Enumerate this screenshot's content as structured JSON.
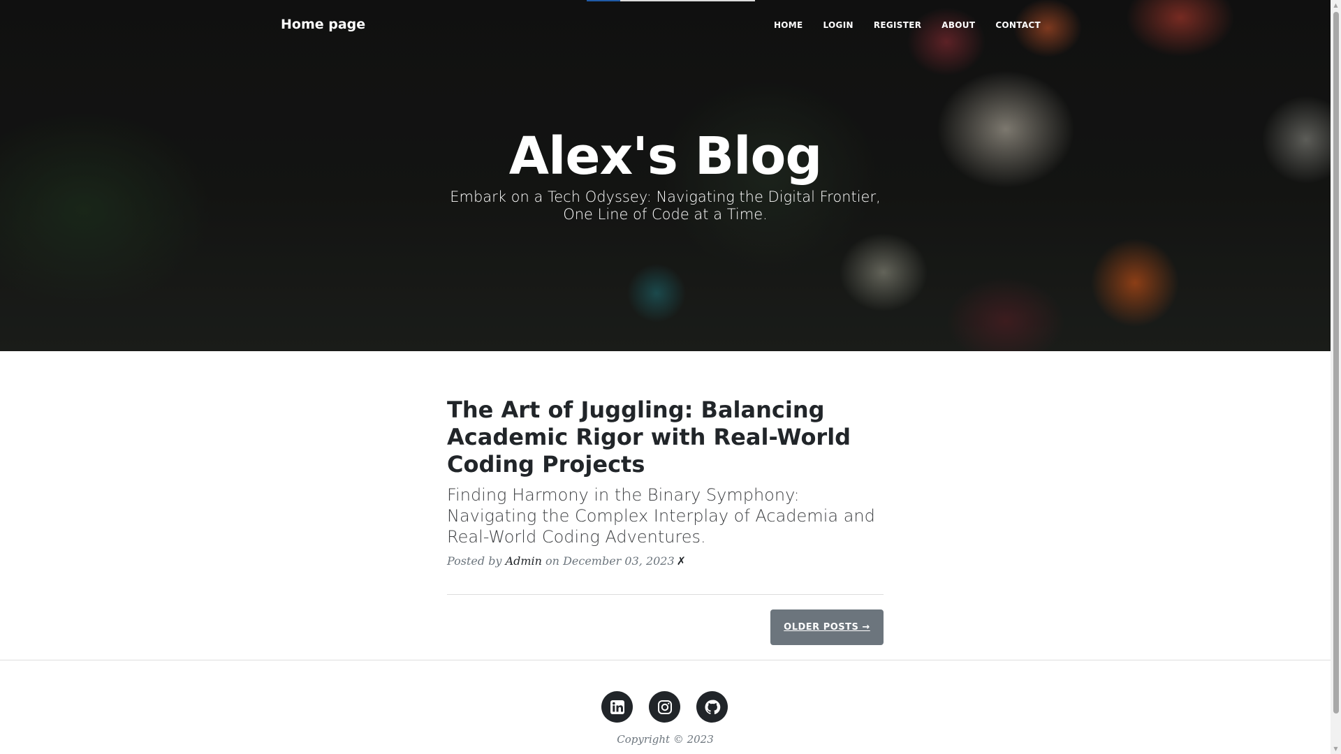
{
  "nav": {
    "brand": "Home page",
    "links": [
      {
        "label": "HOME"
      },
      {
        "label": "LOGIN"
      },
      {
        "label": "REGISTER"
      },
      {
        "label": "ABOUT"
      },
      {
        "label": "CONTACT"
      }
    ]
  },
  "hero": {
    "title": "Alex's Blog",
    "subtitle": "Embark on a Tech Odyssey: Navigating the Digital Frontier, One Line of Code at a Time."
  },
  "posts": [
    {
      "title": "The Art of Juggling: Balancing Academic Rigor with Real-World Coding Projects",
      "subtitle": "Finding Harmony in the Binary Symphony: Navigating the Complex Interplay of Academia and Real-World Coding Adventures.",
      "meta_prefix": "Posted by",
      "author": "Admin",
      "meta_date": "on December 03, 2023",
      "delete_symbol": "✗"
    }
  ],
  "pager": {
    "older_label": "OLDER POSTS →"
  },
  "footer": {
    "social": [
      {
        "icon": "linkedin-icon"
      },
      {
        "icon": "instagram-icon"
      },
      {
        "icon": "github-icon"
      }
    ],
    "copyright": "Copyright © 2023"
  },
  "colors": {
    "button_bg": "#6c757d",
    "social_bg": "#212529",
    "text": "#212529",
    "muted": "#6c757d"
  }
}
